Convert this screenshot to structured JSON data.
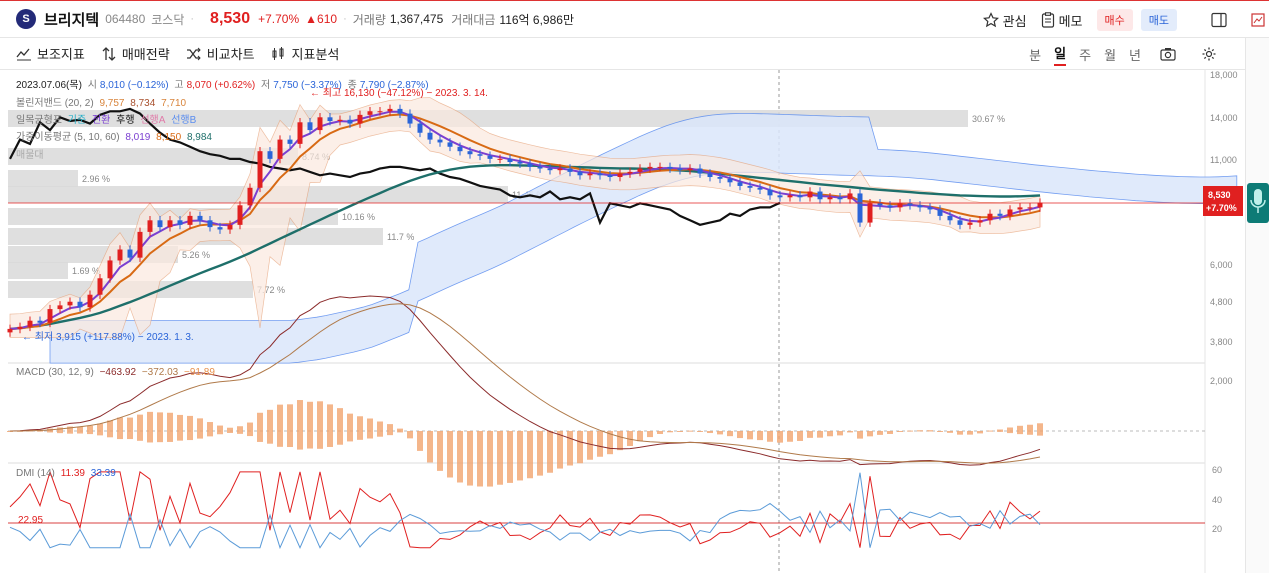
{
  "header": {
    "logo_text": "S",
    "stock_name": "브리지텍",
    "code": "064480",
    "market": "코스닥",
    "price": "8,530",
    "change_pct": "+7.70%",
    "change_amt": "610",
    "volume_label": "거래량",
    "volume": "1,367,475",
    "amount_label": "거래대금",
    "amount": "116억 6,986만",
    "interest_label": "관심",
    "memo_label": "메모",
    "buy_label": "매수",
    "sell_label": "매도"
  },
  "toolbar": {
    "indicator_label": "보조지표",
    "strategy_label": "매매전략",
    "compare_label": "비교차트",
    "analysis_label": "지표분석",
    "periods": [
      "분",
      "일",
      "주",
      "월",
      "년"
    ],
    "active_period": "일"
  },
  "info": {
    "date": "2023.07.06(목)",
    "open_label": "시",
    "open": "8,010 (−0.12%)",
    "high_label": "고",
    "high": "8,070 (+0.62%)",
    "low_label": "저",
    "low": "7,750 (−3.37%)",
    "close_label": "종",
    "close": "7,790 (−2.87%)",
    "bb_label": "볼린저밴드 (20, 2)",
    "bb_v1": "9,757",
    "bb_v2": "8,734",
    "bb_v3": "7,710",
    "ichimoku_label": "일목균형표",
    "ich_1": "기준",
    "ich_2": "전환",
    "ich_3": "후행",
    "ich_4": "선행A",
    "ich_5": "선행B",
    "ma_label": "가중이동평균 (5, 10, 60)",
    "ma_v1": "8,019",
    "ma_v2": "8,150",
    "ma_v3": "8,984",
    "volume_profile_label": "매물대",
    "max_label": "최고 16,130 (−47.12%) − 2023. 3. 14.",
    "min_label": "최저 3,915 (+117.88%) − 2023. 1. 3."
  },
  "price_axis": [
    "18,000",
    "14,000",
    "11,000",
    "8,530",
    "+7.70%",
    "6,000",
    "4,800",
    "3,800"
  ],
  "volume_profile": [
    "30.67 %",
    "8.74 %",
    "2.96 %",
    "11.45 %",
    "10.16 %",
    "11.7 %",
    "5.26 %",
    "1.69 %",
    "7.72 %"
  ],
  "macd": {
    "label": "MACD (30, 12, 9)",
    "v1": "−463.92",
    "v2": "−372.03",
    "v3": "−91.89",
    "axis": "2,000"
  },
  "dmi": {
    "label": "DMI (14)",
    "v1": "11.39",
    "v2": "33.39",
    "level": "22.95",
    "axis": [
      "60",
      "40",
      "20"
    ]
  },
  "colors": {
    "up": "#e02020",
    "down": "#2a64d8",
    "ma60": "#1e6f6a",
    "ma5": "#7b3fd1",
    "ma10": "#d86a14",
    "lagging": "#111111"
  },
  "chart_data": {
    "type": "line",
    "close": [
      4100,
      4150,
      4300,
      4250,
      4600,
      4700,
      4800,
      4650,
      5000,
      5500,
      6100,
      6500,
      6200,
      7200,
      7700,
      7400,
      7700,
      7500,
      7900,
      7700,
      7400,
      7300,
      7500,
      8400,
      9300,
      11500,
      11000,
      12300,
      12000,
      13600,
      13000,
      14000,
      13700,
      13800,
      13500,
      14200,
      14500,
      14500,
      14700,
      14300,
      13500,
      12800,
      12300,
      12100,
      11800,
      11500,
      11300,
      11200,
      11000,
      11000,
      10800,
      10700,
      10500,
      10400,
      10300,
      10400,
      10200,
      10000,
      10100,
      10000,
      9900,
      10100,
      10200,
      10400,
      10500,
      10500,
      10400,
      10300,
      10400,
      10100,
      9900,
      9800,
      9600,
      9400,
      9300,
      9200,
      8900,
      8800,
      8900,
      8800,
      9100,
      8700,
      8800,
      8700,
      9000,
      7600,
      8500,
      8400,
      8300,
      8500,
      8400,
      8300,
      8200,
      7900,
      7700,
      7500,
      7600,
      7700,
      8000,
      7900,
      8200,
      8300,
      8300,
      8530
    ],
    "ma60": [
      4100,
      4120,
      4150,
      4180,
      4220,
      4270,
      4320,
      4370,
      4430,
      4500,
      4590,
      4690,
      4790,
      4900,
      5020,
      5140,
      5270,
      5400,
      5530,
      5660,
      5790,
      5920,
      6060,
      6210,
      6370,
      6550,
      6730,
      6920,
      7110,
      7310,
      7510,
      7720,
      7930,
      8140,
      8360,
      8580,
      8800,
      9020,
      9250,
      9470,
      9680,
      9870,
      10050,
      10200,
      10330,
      10430,
      10510,
      10560,
      10590,
      10600,
      10600,
      10590,
      10580,
      10560,
      10540,
      10520,
      10500,
      10480,
      10460,
      10440,
      10420,
      10410,
      10400,
      10390,
      10370,
      10350,
      10320,
      10290,
      10250,
      10200,
      10150,
      10090,
      10030,
      9970,
      9910,
      9850,
      9790,
      9730,
      9670,
      9610,
      9550,
      9490,
      9440,
      9390,
      9340,
      9290,
      9240,
      9190,
      9150,
      9110,
      9070,
      9030,
      8990,
      8960,
      8930,
      8900,
      8880,
      8860,
      8850,
      8840,
      8840,
      8850,
      8870,
      8900
    ],
    "macd_axis_max": 2000,
    "dmi_levels": [
      60,
      40,
      20
    ],
    "dmi_ref": 22.95
  }
}
